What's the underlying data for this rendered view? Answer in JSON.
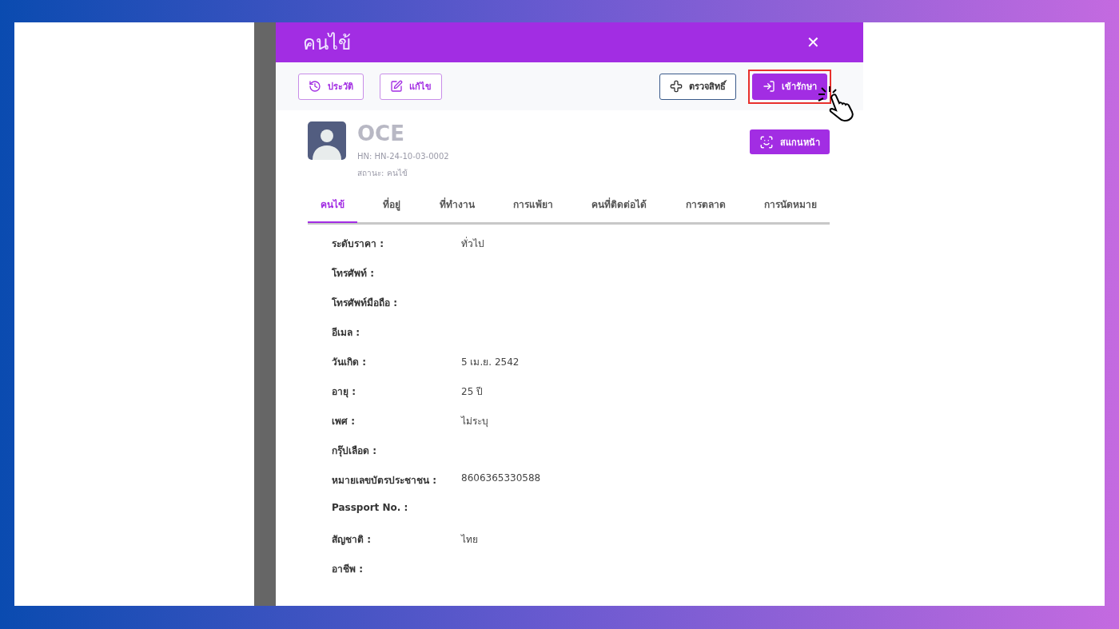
{
  "modal": {
    "title": "คนไข้",
    "close": "✕"
  },
  "toolbar": {
    "left": [
      {
        "label": "ประวัติ",
        "kind": "history",
        "highlighted": false
      },
      {
        "label": "แก้ไข",
        "kind": "edit",
        "highlighted": false
      }
    ],
    "right": [
      {
        "label": "ตรวจสิทธิ์",
        "kind": "rights",
        "highlighted": false
      },
      {
        "label": "เข้ารักษา",
        "kind": "admit",
        "highlighted": true
      }
    ]
  },
  "patient": {
    "name": "OCE",
    "hn": "HN: HN-24-10-03-0002",
    "status": "สถานะ: คนไข้",
    "scan_button": "สแกนหน้า"
  },
  "tabs": [
    {
      "label": "คนไข้",
      "selected": true
    },
    {
      "label": "ที่อยู่",
      "selected": false
    },
    {
      "label": "ที่ทำงาน",
      "selected": false
    },
    {
      "label": "การแพ้ยา",
      "selected": false
    },
    {
      "label": "คนที่ติดต่อได้",
      "selected": false
    },
    {
      "label": "การตลาด",
      "selected": false
    },
    {
      "label": "การนัดหมาย",
      "selected": false
    }
  ],
  "fields": [
    {
      "label": "ระดับราคา :",
      "value": "ทั่วไป"
    },
    {
      "label": "โทรศัพท์ :"
    },
    {
      "label": "โทรศัพท์มือถือ :"
    },
    {
      "label": "อีเมล :"
    },
    {
      "label": "วันเกิด :",
      "value": "5 เม.ย. 2542"
    },
    {
      "label": "อายุ :",
      "value": "25 ปี"
    },
    {
      "label": "เพศ :",
      "value": "ไม่ระบุ"
    },
    {
      "label": "กรุ๊ปเลือด :"
    },
    {
      "label": "หมายเลขบัตรประชาชน :",
      "value": "8606365330588"
    },
    {
      "label": "Passport No. :"
    },
    {
      "label": "สัญชาติ :",
      "value": "ไทย"
    },
    {
      "label": "อาชีพ :"
    }
  ]
}
